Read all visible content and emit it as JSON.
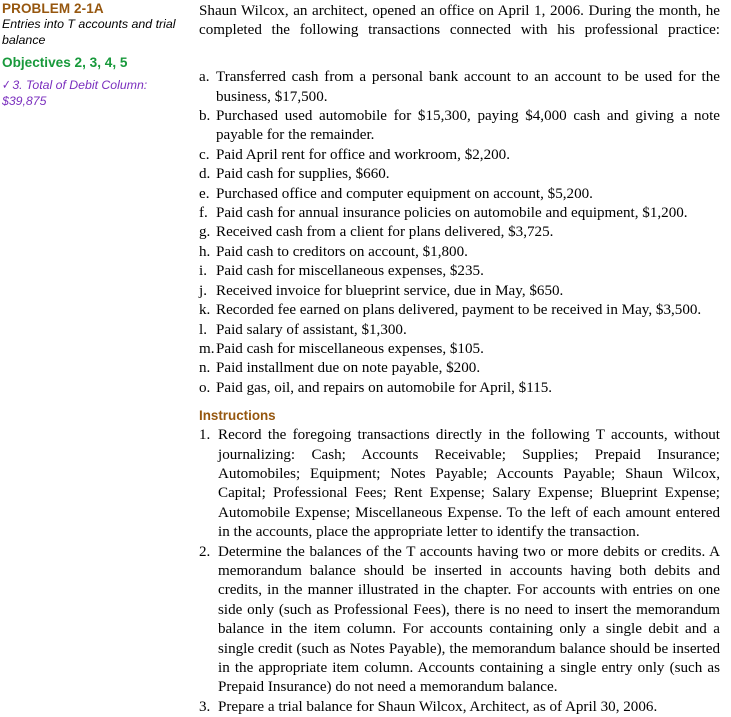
{
  "margin_notes": {
    "problem_label": "PROBLEM 2-1A",
    "problem_subtitle": "Entries into T accounts and trial balance",
    "objectives": "Objectives 2, 3, 4, 5",
    "check_mark_glyph": "✓",
    "check_answer": "3. Total of Debit Column: $39,875",
    "colors": {
      "problem_label": "#96570F",
      "objectives": "#18993B",
      "check_answer": "#7A2EBE",
      "instructions_heading": "#96570F",
      "body_text": "#000000"
    }
  },
  "main": {
    "intro": "Shaun Wilcox, an architect, opened an office on April 1, 2006. During the month, he completed the following transactions connected with his professional practice:",
    "transactions": [
      {
        "marker": "a.",
        "text": "Transferred cash from a personal bank account to an account to be used for the business, $17,500."
      },
      {
        "marker": "b.",
        "text": "Purchased used automobile for $15,300, paying $4,000 cash and giving a note payable for the remainder."
      },
      {
        "marker": "c.",
        "text": "Paid April rent for office and workroom, $2,200."
      },
      {
        "marker": "d.",
        "text": "Paid cash for supplies, $660."
      },
      {
        "marker": "e.",
        "text": "Purchased office and computer equipment on account, $5,200."
      },
      {
        "marker": "f.",
        "text": "Paid cash for annual insurance policies on automobile and equipment, $1,200."
      },
      {
        "marker": "g.",
        "text": "Received cash from a client for plans delivered, $3,725."
      },
      {
        "marker": "h.",
        "text": "Paid cash to creditors on account, $1,800."
      },
      {
        "marker": "i.",
        "text": "Paid cash for miscellaneous expenses, $235."
      },
      {
        "marker": "j.",
        "text": "Received invoice for blueprint service, due in May, $650."
      },
      {
        "marker": "k.",
        "text": "Recorded fee earned on plans delivered, payment to be received in May, $3,500."
      },
      {
        "marker": "l.",
        "text": "Paid salary of assistant, $1,300."
      },
      {
        "marker": "m.",
        "text": "Paid cash for miscellaneous expenses, $105."
      },
      {
        "marker": "n.",
        "text": "Paid installment due on note payable, $200."
      },
      {
        "marker": "o.",
        "text": "Paid gas, oil, and repairs on automobile for April, $115."
      }
    ],
    "instructions_heading": "Instructions",
    "instructions": [
      {
        "marker": "1.",
        "text": "Record the foregoing transactions directly in the following T accounts, without journalizing: Cash; Accounts Receivable; Supplies; Prepaid Insurance; Automobiles; Equipment; Notes Payable; Accounts Payable; Shaun Wilcox, Capital; Professional Fees; Rent Expense; Salary Expense; Blueprint Expense; Automobile Expense; Miscellaneous Expense. To the left of each amount entered in the accounts, place the appropriate letter to identify the transaction."
      },
      {
        "marker": "2.",
        "text": "Determine the balances of the T accounts having two or more debits or credits. A memorandum balance should be inserted in accounts having both debits and credits, in the manner illustrated in the chapter. For accounts with entries on one side only (such as Professional Fees), there is no need to insert the memorandum balance in the item column. For accounts containing only a single debit and a single credit (such as Notes Payable), the memorandum balance should be inserted in the appropriate item column. Accounts containing a single entry only (such as Prepaid Insurance) do not need a memorandum balance."
      },
      {
        "marker": "3.",
        "text": "Prepare a trial balance for Shaun Wilcox, Architect, as of April 30, 2006."
      }
    ]
  }
}
